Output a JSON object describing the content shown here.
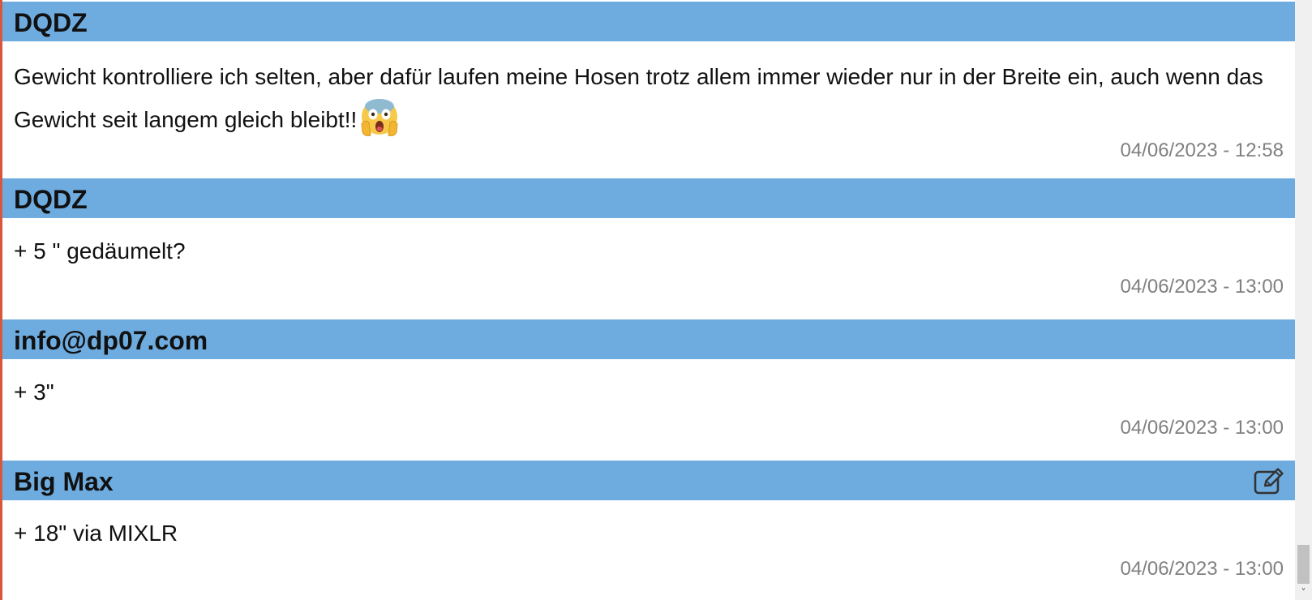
{
  "messages": [
    {
      "author": "DQDZ",
      "text": "Gewicht kontrolliere ich selten, aber dafür laufen meine Hosen trotz allem immer wieder nur in der Breite ein, auch wenn das Gewicht seit langem gleich bleibt!!",
      "emoji": "screaming-face-emoji",
      "timestamp": "04/06/2023 - 12:58"
    },
    {
      "author": "DQDZ",
      "text": "+ 5 \" gedäumelt?",
      "timestamp": "04/06/2023 - 13:00"
    },
    {
      "author": "info@dp07.com",
      "text": "+ 3\"",
      "timestamp": "04/06/2023 - 13:00"
    },
    {
      "author": "Big Max",
      "text": "+ 18\" via MIXLR",
      "timestamp": "04/06/2023 - 13:00",
      "edit_icon": "edit-icon"
    }
  ],
  "colors": {
    "header_bg": "#6eace0",
    "timestamp": "#808080",
    "left_accent": "#d6573b"
  },
  "scrollbar": {
    "down_arrow": "˅"
  }
}
